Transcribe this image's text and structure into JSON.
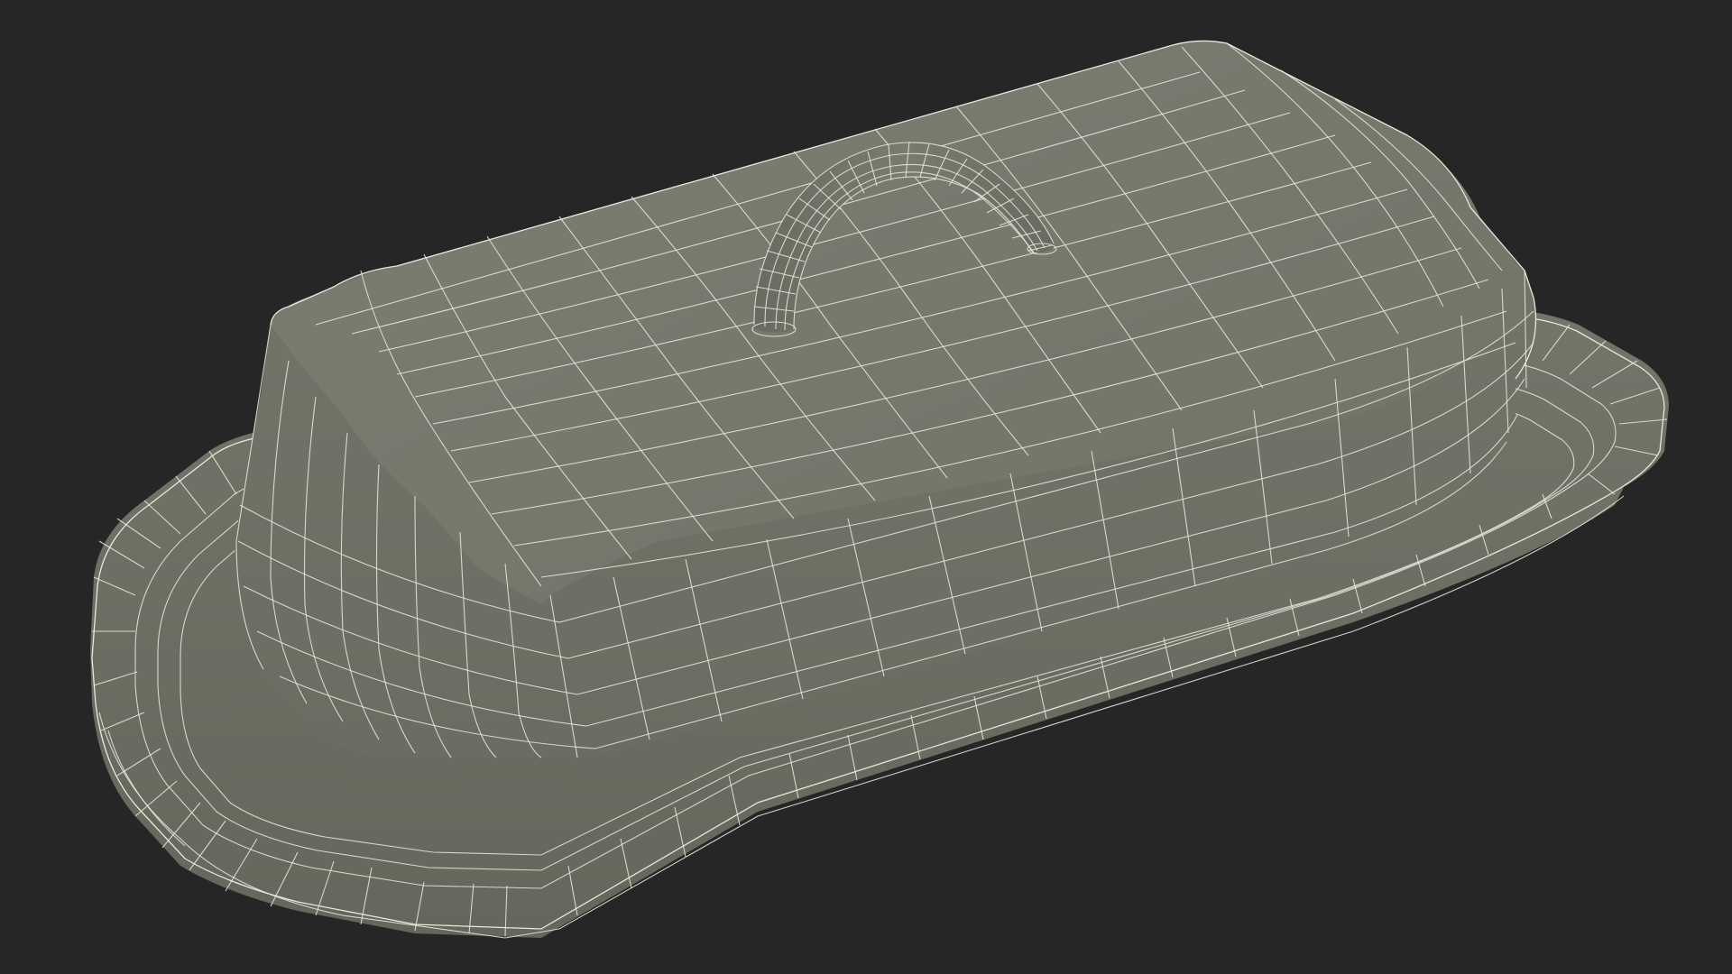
{
  "scene": {
    "subject": "butter-dish",
    "colors": {
      "background": "#262626",
      "mesh_surface": "#737368",
      "mesh_surface_light": "#7c7c71",
      "mesh_surface_dark": "#5f5f55",
      "wireframe": "#e6e6dc"
    }
  }
}
